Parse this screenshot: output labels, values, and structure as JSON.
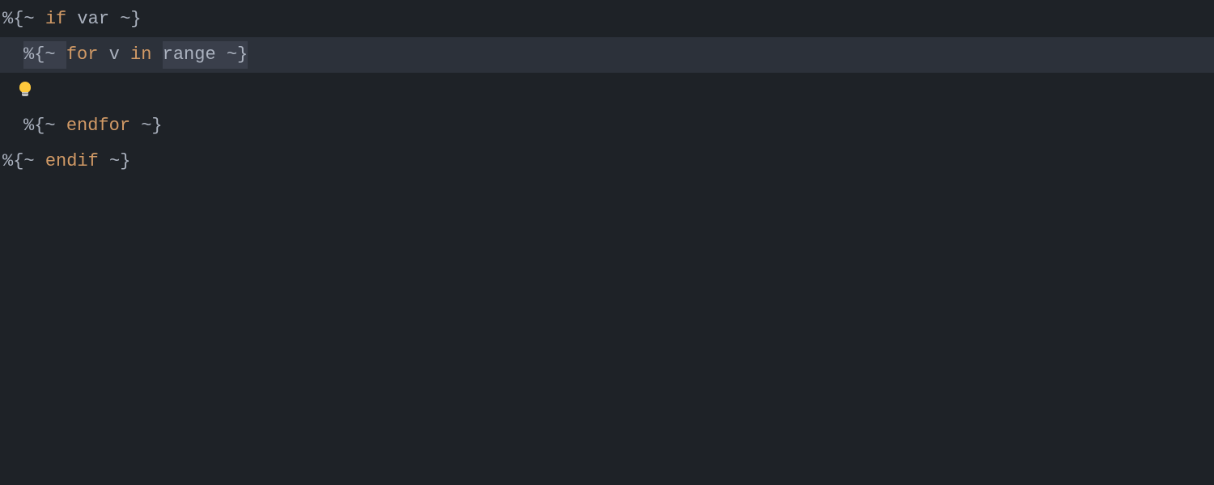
{
  "editor": {
    "lines": [
      {
        "indent": 0,
        "highlighted": false,
        "boxed": false,
        "tokens": {
          "open": "%{~ ",
          "keyword": "if",
          "mid": " ",
          "var": "var",
          "close": " ~}"
        }
      },
      {
        "indent": 1,
        "highlighted": true,
        "boxed": true,
        "tokens": {
          "open": "%{~ ",
          "keyword": "for",
          "mid1": " ",
          "var1": "v",
          "mid2": " ",
          "keyword2": "in",
          "mid3": " ",
          "var2": "range",
          "close": " ~}"
        }
      },
      {
        "lightbulb": true
      },
      {
        "indent": 1,
        "highlighted": false,
        "boxed": false,
        "tokens": {
          "open": "%{~ ",
          "keyword": "endfor",
          "close": " ~}"
        }
      },
      {
        "indent": 0,
        "highlighted": false,
        "boxed": false,
        "tokens": {
          "open": "%{~ ",
          "keyword": "endif",
          "close": " ~}"
        }
      }
    ]
  }
}
